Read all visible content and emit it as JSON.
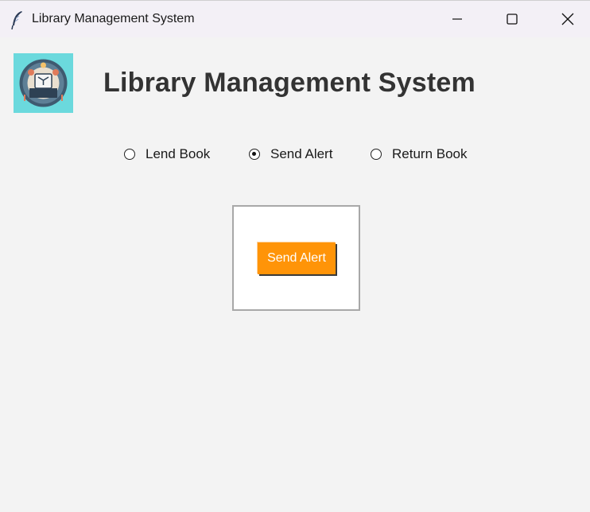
{
  "window": {
    "title": "Library Management System",
    "icon": "feather-icon",
    "controls": [
      "minimize-icon",
      "maximize-icon",
      "close-icon"
    ]
  },
  "header": {
    "title": "Library Management System",
    "logo": "library-logo-icon"
  },
  "options": [
    {
      "label": "Lend Book",
      "selected": false
    },
    {
      "label": "Send Alert",
      "selected": true
    },
    {
      "label": "Return Book",
      "selected": false
    }
  ],
  "panel": {
    "button_label": "Send Alert"
  },
  "colors": {
    "background": "#f3f3f3",
    "titlebar": "#f3f0f6",
    "logo_bg": "#6bd9dd",
    "button_bg": "#ff9408",
    "button_text": "#ffffff",
    "title_text": "#333333"
  }
}
